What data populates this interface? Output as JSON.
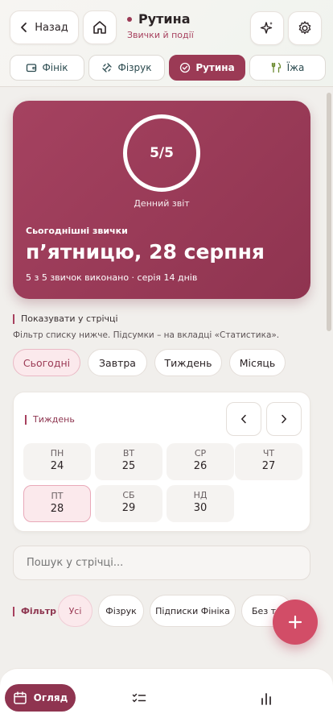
{
  "header": {
    "back_label": "Назад",
    "title": "Рутина",
    "subtitle": "Звички й події"
  },
  "tabs": [
    {
      "label": "Фінік",
      "icon": "wallet-icon"
    },
    {
      "label": "Фізрук",
      "icon": "dumbbell-icon"
    },
    {
      "label": "Рутина",
      "icon": "check-circle-icon",
      "active": true
    },
    {
      "label": "Їжа",
      "icon": "utensils-icon"
    }
  ],
  "hero": {
    "progress": "5/5",
    "progress_fraction": 1.0,
    "caption": "Денний звіт",
    "small_title": "Сьогоднішні звички",
    "date": "п’ятницю, 28 серпня",
    "meta": "5 з 5 звичок виконано · серія 14 днів"
  },
  "show_in_feed": {
    "label": "Показувати у стрічці",
    "hint": "Фільтр списку нижче. Підсумки – на вкладці «Статистика»."
  },
  "periods": [
    {
      "label": "Сьогодні",
      "active": true
    },
    {
      "label": "Завтра"
    },
    {
      "label": "Тиждень"
    },
    {
      "label": "Місяць"
    }
  ],
  "week": {
    "title": "Тиждень",
    "days": [
      {
        "name": "ПН",
        "num": "24"
      },
      {
        "name": "ВТ",
        "num": "25"
      },
      {
        "name": "СР",
        "num": "26"
      },
      {
        "name": "ЧТ",
        "num": "27"
      },
      {
        "name": "ПТ",
        "num": "28",
        "active": true
      },
      {
        "name": "СБ",
        "num": "29"
      },
      {
        "name": "НД",
        "num": "30"
      }
    ]
  },
  "search": {
    "placeholder": "Пошук у стрічці..."
  },
  "filter": {
    "label": "Фільтр",
    "chips": [
      {
        "label": "Усі",
        "active": true
      },
      {
        "label": "Фізрук"
      },
      {
        "label": "Підписки Фініка"
      },
      {
        "label": "Без т"
      }
    ]
  },
  "bottom_nav": {
    "overview_label": "Огляд"
  },
  "colors": {
    "accent": "#9b3a55",
    "fab": "#d24d67"
  }
}
